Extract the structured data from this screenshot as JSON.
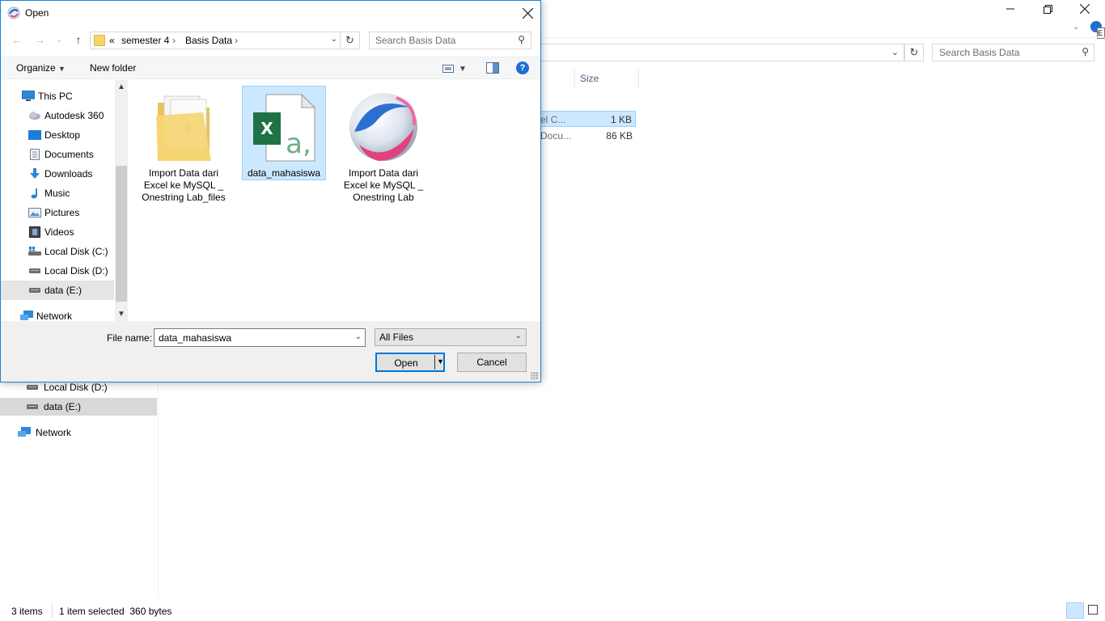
{
  "background_window": {
    "search_placeholder": "Search Basis Data",
    "column_size": "Size",
    "rows": [
      {
        "name_fragment": "el C...",
        "size": "1 KB"
      },
      {
        "name_fragment": "Docu...",
        "size": "86 KB"
      }
    ],
    "nav_items": [
      "Local Disk (D:)",
      "data (E:)",
      "Network"
    ],
    "status": {
      "items": "3 items",
      "selected": "1 item selected  360 bytes"
    }
  },
  "dialog": {
    "title": "Open",
    "breadcrumb": {
      "overflow": "«",
      "segments": [
        "semester 4",
        "Basis Data"
      ]
    },
    "search_placeholder": "Search Basis Data",
    "toolbar": {
      "organize": "Organize",
      "new_folder": "New folder",
      "help": "?"
    },
    "nav_items": [
      {
        "label": "This PC",
        "icon": "pc-icon"
      },
      {
        "label": "Autodesk 360",
        "icon": "cloud-icon"
      },
      {
        "label": "Desktop",
        "icon": "desktop-icon"
      },
      {
        "label": "Documents",
        "icon": "documents-icon"
      },
      {
        "label": "Downloads",
        "icon": "download-icon"
      },
      {
        "label": "Music",
        "icon": "music-icon"
      },
      {
        "label": "Pictures",
        "icon": "pictures-icon"
      },
      {
        "label": "Videos",
        "icon": "videos-icon"
      },
      {
        "label": "Local Disk (C:)",
        "icon": "drive-windows-icon"
      },
      {
        "label": "Local Disk (D:)",
        "icon": "drive-icon"
      },
      {
        "label": "data (E:)",
        "icon": "drive-icon"
      },
      {
        "label": "Network",
        "icon": "network-icon"
      }
    ],
    "files": [
      {
        "label": "Import Data dari Excel ke MySQL _ Onestring Lab_files",
        "icon": "folder-icon"
      },
      {
        "label": "data_mahasiswa",
        "icon": "excel-csv-icon"
      },
      {
        "label": "Import Data dari Excel ke MySQL _ Onestring Lab",
        "icon": "browser-html-icon"
      }
    ],
    "file_name_label": "File name:",
    "file_name_value": "data_mahasiswa",
    "file_type": "All Files",
    "open_label": "Open",
    "cancel_label": "Cancel"
  },
  "colors": {
    "accent": "#0078d7",
    "selection": "#cce8ff",
    "excel_green": "#1f7244"
  }
}
